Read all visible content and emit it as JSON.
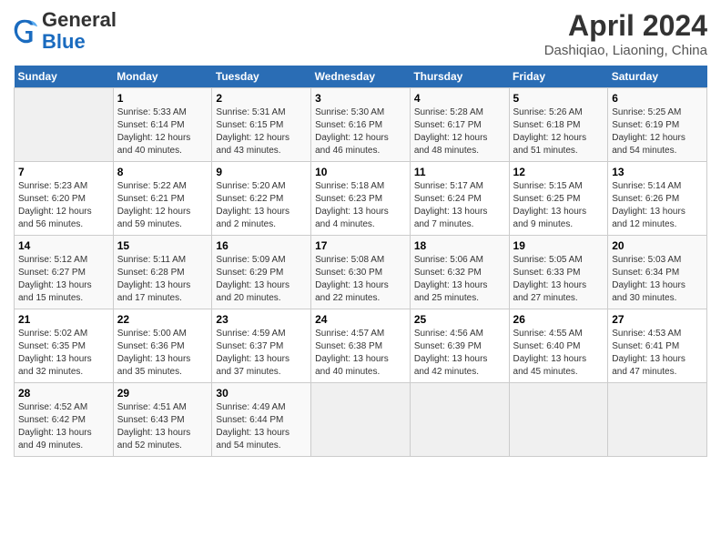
{
  "header": {
    "logo_general": "General",
    "logo_blue": "Blue",
    "main_title": "April 2024",
    "sub_title": "Dashiqiao, Liaoning, China"
  },
  "weekdays": [
    "Sunday",
    "Monday",
    "Tuesday",
    "Wednesday",
    "Thursday",
    "Friday",
    "Saturday"
  ],
  "weeks": [
    [
      {
        "num": "",
        "info": ""
      },
      {
        "num": "1",
        "info": "Sunrise: 5:33 AM\nSunset: 6:14 PM\nDaylight: 12 hours\nand 40 minutes."
      },
      {
        "num": "2",
        "info": "Sunrise: 5:31 AM\nSunset: 6:15 PM\nDaylight: 12 hours\nand 43 minutes."
      },
      {
        "num": "3",
        "info": "Sunrise: 5:30 AM\nSunset: 6:16 PM\nDaylight: 12 hours\nand 46 minutes."
      },
      {
        "num": "4",
        "info": "Sunrise: 5:28 AM\nSunset: 6:17 PM\nDaylight: 12 hours\nand 48 minutes."
      },
      {
        "num": "5",
        "info": "Sunrise: 5:26 AM\nSunset: 6:18 PM\nDaylight: 12 hours\nand 51 minutes."
      },
      {
        "num": "6",
        "info": "Sunrise: 5:25 AM\nSunset: 6:19 PM\nDaylight: 12 hours\nand 54 minutes."
      }
    ],
    [
      {
        "num": "7",
        "info": "Sunrise: 5:23 AM\nSunset: 6:20 PM\nDaylight: 12 hours\nand 56 minutes."
      },
      {
        "num": "8",
        "info": "Sunrise: 5:22 AM\nSunset: 6:21 PM\nDaylight: 12 hours\nand 59 minutes."
      },
      {
        "num": "9",
        "info": "Sunrise: 5:20 AM\nSunset: 6:22 PM\nDaylight: 13 hours\nand 2 minutes."
      },
      {
        "num": "10",
        "info": "Sunrise: 5:18 AM\nSunset: 6:23 PM\nDaylight: 13 hours\nand 4 minutes."
      },
      {
        "num": "11",
        "info": "Sunrise: 5:17 AM\nSunset: 6:24 PM\nDaylight: 13 hours\nand 7 minutes."
      },
      {
        "num": "12",
        "info": "Sunrise: 5:15 AM\nSunset: 6:25 PM\nDaylight: 13 hours\nand 9 minutes."
      },
      {
        "num": "13",
        "info": "Sunrise: 5:14 AM\nSunset: 6:26 PM\nDaylight: 13 hours\nand 12 minutes."
      }
    ],
    [
      {
        "num": "14",
        "info": "Sunrise: 5:12 AM\nSunset: 6:27 PM\nDaylight: 13 hours\nand 15 minutes."
      },
      {
        "num": "15",
        "info": "Sunrise: 5:11 AM\nSunset: 6:28 PM\nDaylight: 13 hours\nand 17 minutes."
      },
      {
        "num": "16",
        "info": "Sunrise: 5:09 AM\nSunset: 6:29 PM\nDaylight: 13 hours\nand 20 minutes."
      },
      {
        "num": "17",
        "info": "Sunrise: 5:08 AM\nSunset: 6:30 PM\nDaylight: 13 hours\nand 22 minutes."
      },
      {
        "num": "18",
        "info": "Sunrise: 5:06 AM\nSunset: 6:32 PM\nDaylight: 13 hours\nand 25 minutes."
      },
      {
        "num": "19",
        "info": "Sunrise: 5:05 AM\nSunset: 6:33 PM\nDaylight: 13 hours\nand 27 minutes."
      },
      {
        "num": "20",
        "info": "Sunrise: 5:03 AM\nSunset: 6:34 PM\nDaylight: 13 hours\nand 30 minutes."
      }
    ],
    [
      {
        "num": "21",
        "info": "Sunrise: 5:02 AM\nSunset: 6:35 PM\nDaylight: 13 hours\nand 32 minutes."
      },
      {
        "num": "22",
        "info": "Sunrise: 5:00 AM\nSunset: 6:36 PM\nDaylight: 13 hours\nand 35 minutes."
      },
      {
        "num": "23",
        "info": "Sunrise: 4:59 AM\nSunset: 6:37 PM\nDaylight: 13 hours\nand 37 minutes."
      },
      {
        "num": "24",
        "info": "Sunrise: 4:57 AM\nSunset: 6:38 PM\nDaylight: 13 hours\nand 40 minutes."
      },
      {
        "num": "25",
        "info": "Sunrise: 4:56 AM\nSunset: 6:39 PM\nDaylight: 13 hours\nand 42 minutes."
      },
      {
        "num": "26",
        "info": "Sunrise: 4:55 AM\nSunset: 6:40 PM\nDaylight: 13 hours\nand 45 minutes."
      },
      {
        "num": "27",
        "info": "Sunrise: 4:53 AM\nSunset: 6:41 PM\nDaylight: 13 hours\nand 47 minutes."
      }
    ],
    [
      {
        "num": "28",
        "info": "Sunrise: 4:52 AM\nSunset: 6:42 PM\nDaylight: 13 hours\nand 49 minutes."
      },
      {
        "num": "29",
        "info": "Sunrise: 4:51 AM\nSunset: 6:43 PM\nDaylight: 13 hours\nand 52 minutes."
      },
      {
        "num": "30",
        "info": "Sunrise: 4:49 AM\nSunset: 6:44 PM\nDaylight: 13 hours\nand 54 minutes."
      },
      {
        "num": "",
        "info": ""
      },
      {
        "num": "",
        "info": ""
      },
      {
        "num": "",
        "info": ""
      },
      {
        "num": "",
        "info": ""
      }
    ]
  ]
}
